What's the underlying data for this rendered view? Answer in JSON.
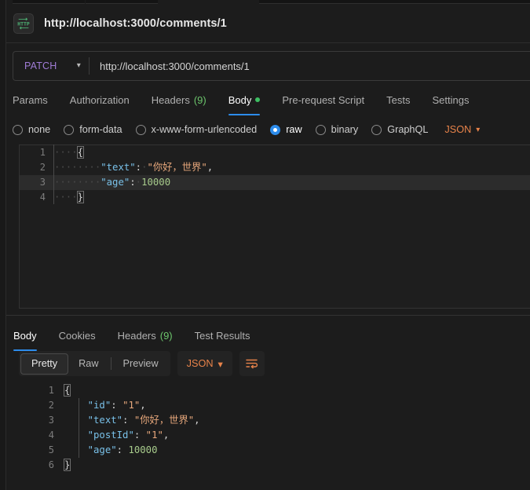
{
  "window": {
    "http_icon": "http-icon",
    "title": "http://localhost:3000/comments/1"
  },
  "request": {
    "method": "PATCH",
    "method_chevron": "chevron-down-icon",
    "url": "http://localhost:3000/comments/1",
    "tabs": [
      {
        "label": "Params",
        "count": "",
        "active": false,
        "dot": false
      },
      {
        "label": "Authorization",
        "count": "",
        "active": false,
        "dot": false
      },
      {
        "label": "Headers",
        "count": "(9)",
        "active": false,
        "dot": false
      },
      {
        "label": "Body",
        "count": "",
        "active": true,
        "dot": true
      },
      {
        "label": "Pre-request Script",
        "count": "",
        "active": false,
        "dot": false
      },
      {
        "label": "Tests",
        "count": "",
        "active": false,
        "dot": false
      },
      {
        "label": "Settings",
        "count": "",
        "active": false,
        "dot": false
      }
    ],
    "body_types": [
      {
        "label": "none",
        "selected": false
      },
      {
        "label": "form-data",
        "selected": false
      },
      {
        "label": "x-www-form-urlencoded",
        "selected": false
      },
      {
        "label": "raw",
        "selected": true
      },
      {
        "label": "binary",
        "selected": false
      },
      {
        "label": "GraphQL",
        "selected": false
      }
    ],
    "format": "JSON",
    "format_chevron": "chevron-down-icon",
    "body_lines": [
      {
        "num": "1",
        "highlighted": false
      },
      {
        "num": "2",
        "highlighted": false
      },
      {
        "num": "3",
        "highlighted": true
      },
      {
        "num": "4",
        "highlighted": false
      }
    ],
    "body_code": {
      "line1_brace": "{",
      "line2_key": "\"text\"",
      "line2_colon": ":",
      "line2_value": "\"你好，世界\"",
      "line2_comma": ",",
      "line3_key": "\"age\"",
      "line3_colon": ":",
      "line3_value": "10000",
      "line4_brace": "}"
    }
  },
  "response": {
    "tabs": [
      {
        "label": "Body",
        "count": "",
        "active": true
      },
      {
        "label": "Cookies",
        "count": "",
        "active": false
      },
      {
        "label": "Headers",
        "count": "(9)",
        "active": false
      },
      {
        "label": "Test Results",
        "count": "",
        "active": false
      }
    ],
    "view_modes": [
      {
        "label": "Pretty",
        "active": true
      },
      {
        "label": "Raw",
        "active": false
      },
      {
        "label": "Preview",
        "active": false
      }
    ],
    "format": "JSON",
    "format_chevron": "chevron-down-icon",
    "wrap_icon": "word-wrap-icon",
    "body_lines": [
      {
        "num": "1"
      },
      {
        "num": "2"
      },
      {
        "num": "3"
      },
      {
        "num": "4"
      },
      {
        "num": "5"
      },
      {
        "num": "6"
      }
    ],
    "body_code": {
      "line1_brace": "{",
      "line2_key": "\"id\"",
      "line2_colon": ":",
      "line2_value": "\"1\"",
      "line2_comma": ",",
      "line3_key": "\"text\"",
      "line3_colon": ":",
      "line3_value": "\"你好，世界\"",
      "line3_comma": ",",
      "line4_key": "\"postId\"",
      "line4_colon": ":",
      "line4_value": "\"1\"",
      "line4_comma": ",",
      "line5_key": "\"age\"",
      "line5_colon": ":",
      "line5_value": "10000",
      "line6_brace": "}"
    }
  },
  "colors": {
    "accent_blue": "#2d8ceb",
    "status_green": "#3dbf62",
    "method_purple": "#a07cd6",
    "format_orange": "#e8834a",
    "json_key": "#79c0e8",
    "json_string": "#e8a87c",
    "json_number": "#a8cc8c"
  }
}
